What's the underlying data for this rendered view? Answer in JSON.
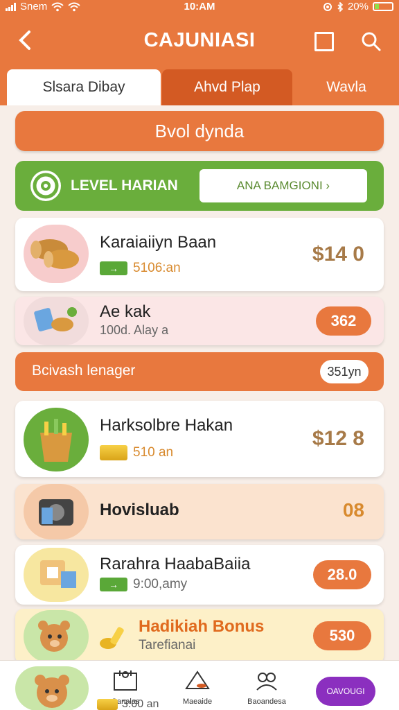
{
  "status_bar": {
    "carrier": "Snem",
    "time": "10:AM",
    "battery": "20%"
  },
  "header": {
    "title": "CAJUNIASI"
  },
  "tabs": [
    {
      "label": "Slsara Dibay"
    },
    {
      "label": "Ahvd Plap"
    },
    {
      "label": "Wavla"
    }
  ],
  "action_button": {
    "label": "Bvol dynda"
  },
  "level_banner": {
    "label": "LEVEL HARIAN",
    "button_label": "ANA BAMGIONI ›"
  },
  "items": [
    {
      "name": "Karaiaiiyn Baan",
      "sub": "5106:an",
      "price": "$14 0"
    },
    {
      "name": "Ae kak",
      "sub": "100d. Alay a",
      "badge": "362"
    }
  ],
  "section": {
    "title": "Bcivash lenager",
    "pill": "351yn"
  },
  "items2": [
    {
      "name": "Harksolbre Hakan",
      "sub": "510 an",
      "price": "$12 8"
    },
    {
      "name": "Hovisluab",
      "badge": "08"
    },
    {
      "name": "Rarahra HaabaBaiia",
      "sub": "9:00,amy",
      "badge": "28.0"
    },
    {
      "name": "Hadikiah Bonus",
      "sub": "Tarefianai",
      "badge": "530"
    }
  ],
  "bottom_nav": [
    {
      "label": "Ganalas"
    },
    {
      "label": "Maeaide"
    },
    {
      "label": "Baoandesa"
    },
    {
      "label": "OAVOUGI"
    }
  ],
  "bottom_sub": "3:00 an",
  "colors": {
    "primary_orange": "#e8783e",
    "green": "#6aae3c",
    "purple": "#8b2fbf"
  }
}
